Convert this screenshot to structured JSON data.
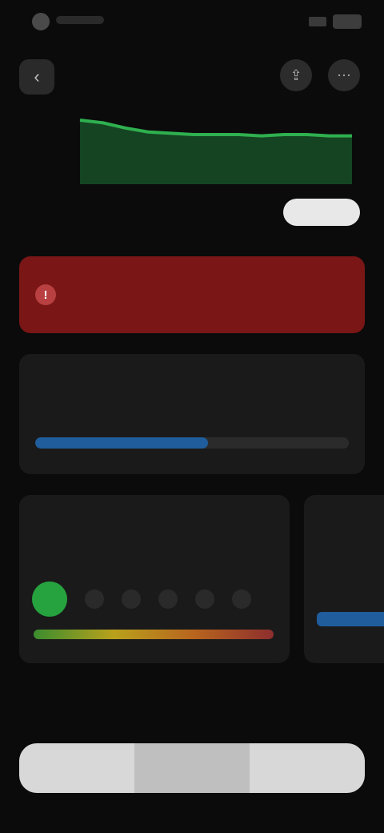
{
  "header": {
    "back_icon": "chevron-left-icon",
    "actions": [
      {
        "icon": "share-icon",
        "glyph": "⇪"
      },
      {
        "icon": "more-icon",
        "glyph": "⋯"
      }
    ]
  },
  "chart_data": {
    "type": "area",
    "title": "",
    "xlabel": "",
    "ylabel": "",
    "color": "#1f8a3d",
    "x": [
      0,
      1,
      2,
      3,
      4,
      5,
      6,
      7,
      8,
      9,
      10,
      11,
      12
    ],
    "values": [
      62,
      60,
      56,
      53,
      52,
      51,
      51,
      51,
      50,
      51,
      51,
      50,
      50
    ],
    "ylim": [
      0,
      100
    ],
    "yticks": [
      "",
      ""
    ]
  },
  "range_tabs": [
    "",
    "",
    "",
    "",
    ""
  ],
  "active_range_index": 4,
  "alert": {
    "icon": "warning-icon",
    "title": "",
    "value": "",
    "sub": "",
    "color": "#7a1616"
  },
  "info": {
    "label": "",
    "value": "",
    "unit": "",
    "note": "",
    "progress": 0.55,
    "color": "#1f5d9d"
  },
  "rating": {
    "title": "",
    "desc": "",
    "steps": [
      "",
      "",
      "",
      "",
      "",
      ""
    ],
    "active_index": 0
  },
  "side": {
    "title": "",
    "label": "",
    "value": ""
  },
  "section_label": "",
  "segments": [
    "",
    "",
    ""
  ]
}
